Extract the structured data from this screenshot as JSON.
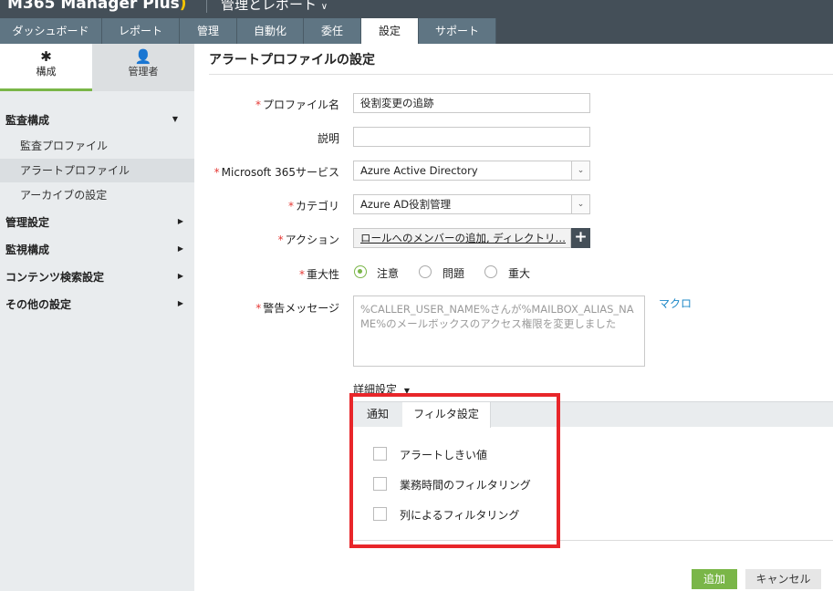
{
  "app": {
    "brand": "M365 Manager Plus",
    "module": "管理とレポート"
  },
  "tabs": [
    "ダッシュボード",
    "レポート",
    "管理",
    "自動化",
    "委任",
    "設定",
    "サポート"
  ],
  "sidebar": {
    "subtabs": [
      "構成",
      "管理者"
    ],
    "sections": [
      {
        "label": "監査構成",
        "items": [
          "監査プロファイル",
          "アラートプロファイル",
          "アーカイブの設定"
        ]
      },
      {
        "label": "管理設定"
      },
      {
        "label": "監視構成"
      },
      {
        "label": "コンテンツ検索設定"
      },
      {
        "label": "その他の設定"
      }
    ]
  },
  "page": {
    "title": "アラートプロファイルの設定"
  },
  "form": {
    "profile_name_label": "プロファイル名",
    "profile_name": "役割変更の追跡",
    "description_label": "説明",
    "description": "",
    "service_label": "Microsoft 365サービス",
    "service": "Azure Active Directory",
    "category_label": "カテゴリ",
    "category": "Azure AD役割管理",
    "action_label": "アクション",
    "action": "ロールへのメンバーの追加, ディレクトリ…",
    "severity_label": "重大性",
    "severity_options": [
      "注意",
      "問題",
      "重大"
    ],
    "severity_selected": "注意",
    "message_label": "警告メッセージ",
    "message": "%CALLER_USER_NAME%さんが%MAILBOX_ALIAS_NAME%のメールボックスのアクセス権限を変更しました",
    "macro": "マクロ",
    "advanced": "詳細設定"
  },
  "advanced": {
    "tabs": [
      "通知",
      "フィルタ設定"
    ],
    "active_tab": "フィルタ設定",
    "filters": [
      {
        "label": "アラートしきい値",
        "checked": false
      },
      {
        "label": "業務時間のフィルタリング",
        "checked": false
      },
      {
        "label": "列によるフィルタリング",
        "checked": false
      }
    ]
  },
  "buttons": {
    "add": "追加",
    "cancel": "キャンセル"
  }
}
